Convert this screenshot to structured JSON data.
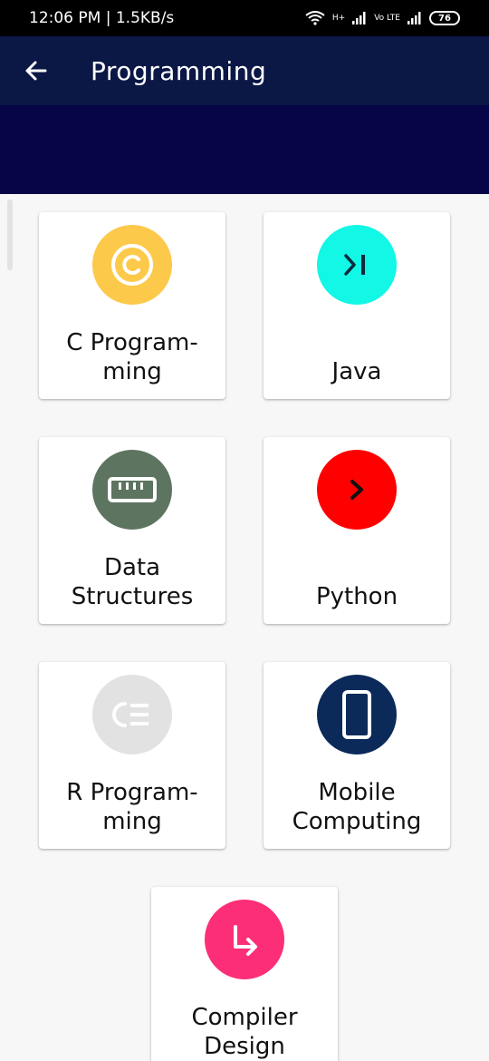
{
  "status_bar": {
    "time": "12:06 PM | 1.5KB/s",
    "network_label": "H+",
    "volte_label": "Vo LTE",
    "battery": "76"
  },
  "app_bar": {
    "title": "Programming"
  },
  "cards": [
    {
      "label": "C Program-ming",
      "line1": "C   Program-",
      "line2": "ming",
      "icon": "copyright-icon",
      "color": "#fdc94a"
    },
    {
      "label": "Java",
      "line1": "",
      "line2": "Java",
      "icon": "skip-forward-icon",
      "color": "#12f7e6"
    },
    {
      "label": "Data Structures",
      "line1": "Data",
      "line2": "Structures",
      "icon": "ruler-icon",
      "color": "#5d7460"
    },
    {
      "label": "Python",
      "line1": "",
      "line2": "Python",
      "icon": "chevron-right-icon",
      "color": "#ff0000"
    },
    {
      "label": "R Program-ming",
      "line1": "R   Program-",
      "line2": "ming",
      "icon": "list-icon",
      "color": "#e2e2e2"
    },
    {
      "label": "Mobile Computing",
      "line1": "Mobile",
      "line2": "Computing",
      "icon": "smartphone-icon",
      "color": "#0b2a5a"
    },
    {
      "label": "Compiler Design",
      "line1": "Compiler",
      "line2": "Design",
      "icon": "arrow-down-right-icon",
      "color": "#fd2e78"
    }
  ]
}
